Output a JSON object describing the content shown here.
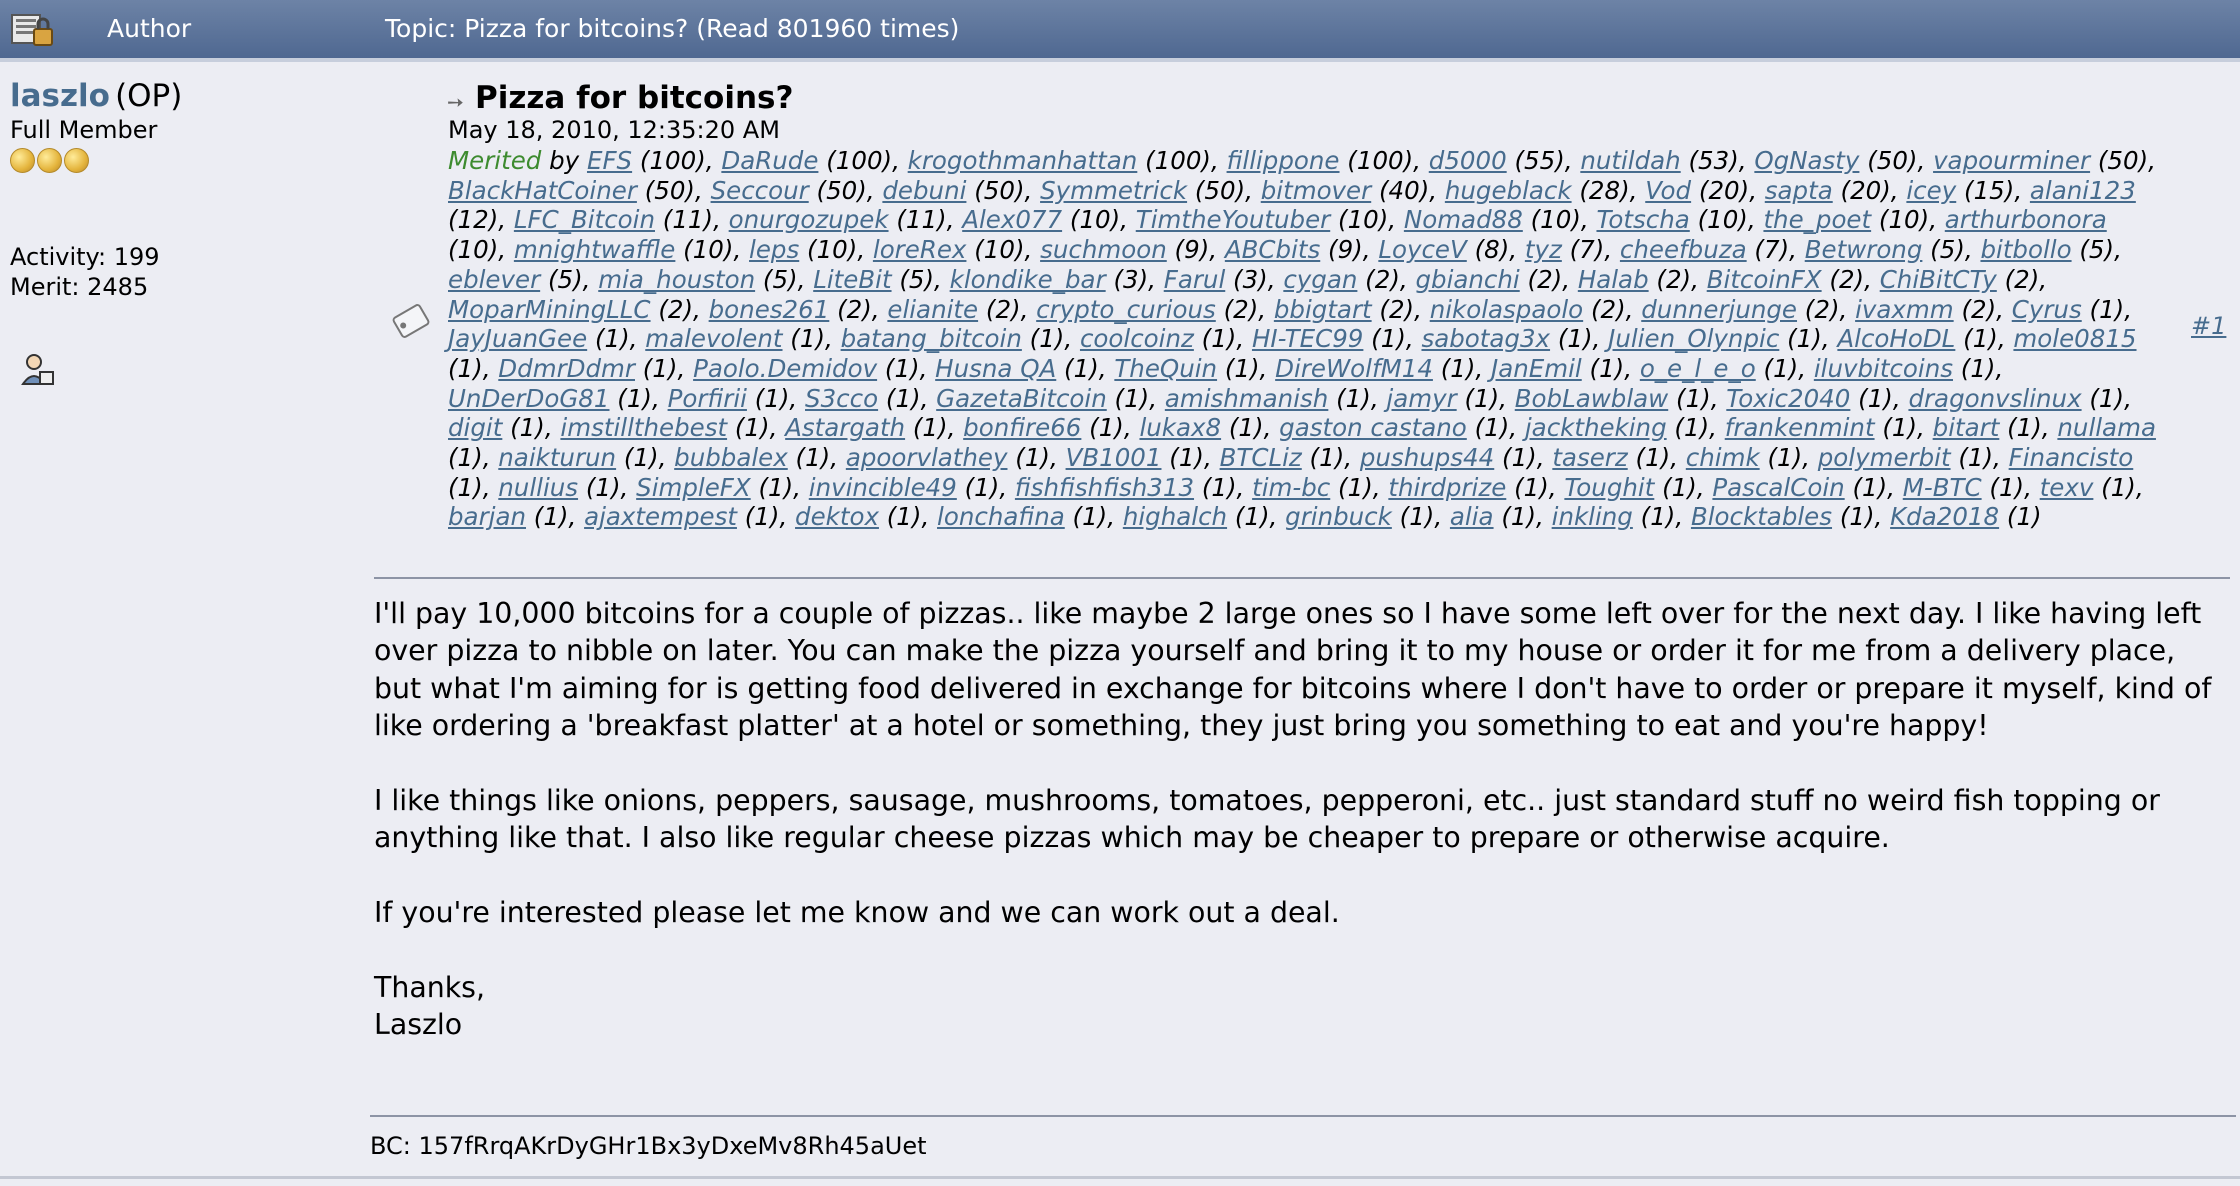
{
  "header": {
    "author_label": "Author",
    "topic_label": "Topic: Pizza for bitcoins?  (Read 801960 times)"
  },
  "author": {
    "name": "laszlo",
    "op_tag": "(OP)",
    "rank": "Full Member",
    "activity": "Activity: 199",
    "merit": "Merit: 2485"
  },
  "post": {
    "title": "Pizza for bitcoins?",
    "date": "May 18, 2010, 12:35:20 AM",
    "number": "#1",
    "merited_label": "Merited",
    "by_label": "by",
    "merits": [
      {
        "user": "EFS",
        "points": "100"
      },
      {
        "user": "DaRude",
        "points": "100"
      },
      {
        "user": "krogothmanhattan",
        "points": "100"
      },
      {
        "user": "fillippone",
        "points": "100"
      },
      {
        "user": "d5000",
        "points": "55"
      },
      {
        "user": "nutildah",
        "points": "53"
      },
      {
        "user": "OgNasty",
        "points": "50"
      },
      {
        "user": "vapourminer",
        "points": "50"
      },
      {
        "user": "BlackHatCoiner",
        "points": "50"
      },
      {
        "user": "Seccour",
        "points": "50"
      },
      {
        "user": "debuni",
        "points": "50"
      },
      {
        "user": "Symmetrick",
        "points": "50"
      },
      {
        "user": "bitmover",
        "points": "40"
      },
      {
        "user": "hugeblack",
        "points": "28"
      },
      {
        "user": "Vod",
        "points": "20"
      },
      {
        "user": "sapta",
        "points": "20"
      },
      {
        "user": "icey",
        "points": "15"
      },
      {
        "user": "alani123",
        "points": "12"
      },
      {
        "user": "LFC_Bitcoin",
        "points": "11"
      },
      {
        "user": "onurgozupek",
        "points": "11"
      },
      {
        "user": "Alex077",
        "points": "10"
      },
      {
        "user": "TimtheYoutuber",
        "points": "10"
      },
      {
        "user": "Nomad88",
        "points": "10"
      },
      {
        "user": "Totscha",
        "points": "10"
      },
      {
        "user": "the_poet",
        "points": "10"
      },
      {
        "user": "arthurbonora",
        "points": "10"
      },
      {
        "user": "mnightwaffle",
        "points": "10"
      },
      {
        "user": "leps",
        "points": "10"
      },
      {
        "user": "loreRex",
        "points": "10"
      },
      {
        "user": "suchmoon",
        "points": "9"
      },
      {
        "user": "ABCbits",
        "points": "9"
      },
      {
        "user": "LoyceV",
        "points": "8"
      },
      {
        "user": "tyz",
        "points": "7"
      },
      {
        "user": "cheefbuza",
        "points": "7"
      },
      {
        "user": "Betwrong",
        "points": "5"
      },
      {
        "user": "bitbollo",
        "points": "5"
      },
      {
        "user": "eblever",
        "points": "5"
      },
      {
        "user": "mia_houston",
        "points": "5"
      },
      {
        "user": "LiteBit",
        "points": "5"
      },
      {
        "user": "klondike_bar",
        "points": "3"
      },
      {
        "user": "Farul",
        "points": "3"
      },
      {
        "user": "cygan",
        "points": "2"
      },
      {
        "user": "gbianchi",
        "points": "2"
      },
      {
        "user": "Halab",
        "points": "2"
      },
      {
        "user": "BitcoinFX",
        "points": "2"
      },
      {
        "user": "ChiBitCTy",
        "points": "2"
      },
      {
        "user": "MoparMiningLLC",
        "points": "2"
      },
      {
        "user": "bones261",
        "points": "2"
      },
      {
        "user": "elianite",
        "points": "2"
      },
      {
        "user": "crypto_curious",
        "points": "2"
      },
      {
        "user": "bbigtart",
        "points": "2"
      },
      {
        "user": "nikolaspaolo",
        "points": "2"
      },
      {
        "user": "dunnerjunge",
        "points": "2"
      },
      {
        "user": "ivaxmm",
        "points": "2"
      },
      {
        "user": "Cyrus",
        "points": "1"
      },
      {
        "user": "JayJuanGee",
        "points": "1"
      },
      {
        "user": "malevolent",
        "points": "1"
      },
      {
        "user": "batang_bitcoin",
        "points": "1"
      },
      {
        "user": "coolcoinz",
        "points": "1"
      },
      {
        "user": "HI-TEC99",
        "points": "1"
      },
      {
        "user": "sabotag3x",
        "points": "1"
      },
      {
        "user": "Julien_Olynpic",
        "points": "1"
      },
      {
        "user": "AlcoHoDL",
        "points": "1"
      },
      {
        "user": "mole0815",
        "points": "1"
      },
      {
        "user": "DdmrDdmr",
        "points": "1"
      },
      {
        "user": "Paolo.Demidov",
        "points": "1"
      },
      {
        "user": "Husna QA",
        "points": "1"
      },
      {
        "user": "TheQuin",
        "points": "1"
      },
      {
        "user": "DireWolfM14",
        "points": "1"
      },
      {
        "user": "JanEmil",
        "points": "1"
      },
      {
        "user": "o_e_l_e_o",
        "points": "1"
      },
      {
        "user": "iluvbitcoins",
        "points": "1"
      },
      {
        "user": "UnDerDoG81",
        "points": "1"
      },
      {
        "user": "Porfirii",
        "points": "1"
      },
      {
        "user": "S3cco",
        "points": "1"
      },
      {
        "user": "GazetaBitcoin",
        "points": "1"
      },
      {
        "user": "amishmanish",
        "points": "1"
      },
      {
        "user": "jamyr",
        "points": "1"
      },
      {
        "user": "BobLawblaw",
        "points": "1"
      },
      {
        "user": "Toxic2040",
        "points": "1"
      },
      {
        "user": "dragonvslinux",
        "points": "1"
      },
      {
        "user": "digit",
        "points": "1"
      },
      {
        "user": "imstillthebest",
        "points": "1"
      },
      {
        "user": "Astargath",
        "points": "1"
      },
      {
        "user": "bonfire66",
        "points": "1"
      },
      {
        "user": "lukax8",
        "points": "1"
      },
      {
        "user": "gaston castano",
        "points": "1"
      },
      {
        "user": "jacktheking",
        "points": "1"
      },
      {
        "user": "frankenmint",
        "points": "1"
      },
      {
        "user": "bitart",
        "points": "1"
      },
      {
        "user": "nullama",
        "points": "1"
      },
      {
        "user": "naikturun",
        "points": "1"
      },
      {
        "user": "bubbalex",
        "points": "1"
      },
      {
        "user": "apoorvlathey",
        "points": "1"
      },
      {
        "user": "VB1001",
        "points": "1"
      },
      {
        "user": "BTCLiz",
        "points": "1"
      },
      {
        "user": "pushups44",
        "points": "1"
      },
      {
        "user": "taserz",
        "points": "1"
      },
      {
        "user": "chimk",
        "points": "1"
      },
      {
        "user": "polymerbit",
        "points": "1"
      },
      {
        "user": "Financisto",
        "points": "1"
      },
      {
        "user": "nullius",
        "points": "1"
      },
      {
        "user": "SimpleFX",
        "points": "1"
      },
      {
        "user": "invincible49",
        "points": "1"
      },
      {
        "user": "fishfishfish313",
        "points": "1"
      },
      {
        "user": "tim-bc",
        "points": "1"
      },
      {
        "user": "thirdprize",
        "points": "1"
      },
      {
        "user": "Toughit",
        "points": "1"
      },
      {
        "user": "PascalCoin",
        "points": "1"
      },
      {
        "user": "M-BTC",
        "points": "1"
      },
      {
        "user": "texv",
        "points": "1"
      },
      {
        "user": "barjan",
        "points": "1"
      },
      {
        "user": "ajaxtempest",
        "points": "1"
      },
      {
        "user": "dektox",
        "points": "1"
      },
      {
        "user": "lonchafina",
        "points": "1"
      },
      {
        "user": "highalch",
        "points": "1"
      },
      {
        "user": "grinbuck",
        "points": "1"
      },
      {
        "user": "alia",
        "points": "1"
      },
      {
        "user": "inkling",
        "points": "1"
      },
      {
        "user": "Blocktables",
        "points": "1"
      },
      {
        "user": "Kda2018",
        "points": "1"
      }
    ],
    "body_paragraphs": [
      "I'll pay 10,000 bitcoins for a couple of pizzas.. like maybe 2 large ones so I have some left over for the next day.  I like having left over pizza to nibble on later.  You can make the pizza yourself and bring it to my house or order it for me from a delivery place, but what I'm aiming for is getting food delivered in exchange for bitcoins where I don't have to order or prepare it myself, kind of like ordering a 'breakfast platter' at a hotel or something, they just bring you something to eat and you're happy!",
      "I like things like onions, peppers, sausage, mushrooms, tomatoes, pepperoni, etc.. just standard stuff no weird fish topping or anything like that.  I also like regular cheese pizzas which may be cheaper to prepare or otherwise acquire.",
      "If you're interested please let me know and we can work out a deal."
    ],
    "closing_lines": [
      "Thanks,",
      "Laszlo"
    ],
    "signature": "BC: 157fRrqAKrDyGHr1Bx3yDxeMv8Rh45aUet"
  },
  "colors": {
    "header_bg": "#5a7399",
    "page_bg": "#ecedf3",
    "link": "#476c8e",
    "merited": "#3d8b2f"
  },
  "icons": [
    "topic-locked-icon",
    "rank-star-icon",
    "profile-icon",
    "post-icon",
    "arrow-icon"
  ]
}
